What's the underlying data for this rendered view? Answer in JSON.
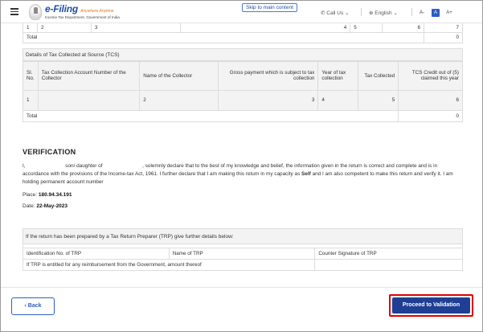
{
  "header": {
    "brand_main": "e-Filing",
    "brand_tag": "Anywhere Anytime",
    "brand_sub": "Income Tax Department, Government of India",
    "skip_link": "Skip to main content",
    "call_us": "Call Us",
    "language": "English",
    "font_smaller": "A-",
    "font_default": "A",
    "font_larger": "A+"
  },
  "tds_table": {
    "number_row": [
      "1",
      "2",
      "3",
      "4",
      "5",
      "6",
      "7"
    ],
    "total_label": "Total",
    "total_value": "0"
  },
  "tcs_table": {
    "section_title": "Details of Tax Collected at Source (TCS)",
    "headers": [
      "Sl. No.",
      "Tax Collection Account Number of the Collector",
      "Name of the Collector",
      "Gross payment which is subject to tax collection",
      "Year of tax collection",
      "Tax Collected",
      "TCS Credit out of (5) claimed this year"
    ],
    "number_row": [
      "1",
      "2",
      "3",
      "4",
      "5",
      "6"
    ],
    "total_label": "Total",
    "total_value": "0"
  },
  "verification": {
    "title": "VERIFICATION",
    "para_1": "I,                            son/ daughter of                            , solemnly declare that to the best of my knowledge and belief, the information given in the return is correct and complete and is in accordance with the provisions of the Income-tax Act, 1961. I further declare that I am making this return in my capacity as",
    "capacity": "Self",
    "para_2": "and I am also competent to make this return and verify it. I am holding permanent account number",
    "place_label": "Place:",
    "place_value": "180.94.34.191",
    "date_label": "Date:",
    "date_value": "22-May-2023"
  },
  "trp": {
    "title": "If the return has been prepared by a Tax Return Preparer (TRP) give further details below:",
    "col_1": "Identification No. of TRP",
    "col_2": "Name of TRP",
    "col_3": "Counter Signature of TRP",
    "reimbursement": "If TRP is entitled for any reimbursement from the Government, amount thereof"
  },
  "footer": {
    "back_label": "Back",
    "proceed_label": "Proceed to Validation"
  },
  "colors": {
    "brand_blue": "#1c4fa8",
    "button_blue": "#1f3f94",
    "highlight_red": "#e00000",
    "tag_orange": "#e07a1f"
  }
}
